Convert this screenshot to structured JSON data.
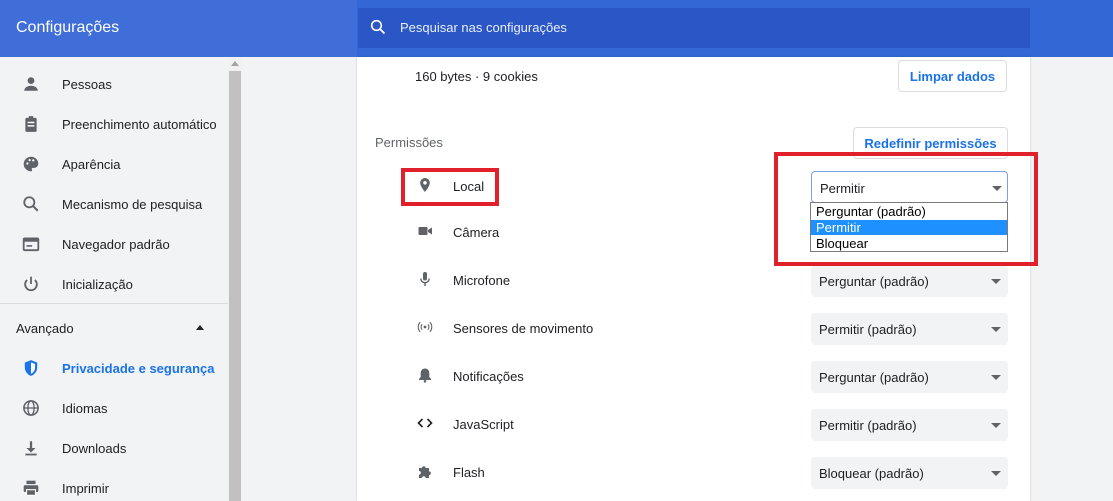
{
  "app": {
    "title": "Configurações"
  },
  "search": {
    "placeholder": "Pesquisar nas configurações"
  },
  "sidebar": {
    "items": [
      {
        "label": "Pessoas",
        "icon": "person-icon"
      },
      {
        "label": "Preenchimento automático",
        "icon": "clipboard-icon"
      },
      {
        "label": "Aparência",
        "icon": "palette-icon"
      },
      {
        "label": "Mecanismo de pesquisa",
        "icon": "search-icon"
      },
      {
        "label": "Navegador padrão",
        "icon": "browser-icon"
      },
      {
        "label": "Inicialização",
        "icon": "power-icon"
      }
    ],
    "advanced_label": "Avançado",
    "advanced_items": [
      {
        "label": "Privacidade e segurança",
        "icon": "shield-icon",
        "active": true
      },
      {
        "label": "Idiomas",
        "icon": "globe-icon"
      },
      {
        "label": "Downloads",
        "icon": "download-icon"
      },
      {
        "label": "Imprimir",
        "icon": "printer-icon"
      }
    ]
  },
  "site": {
    "storage_info": "160 bytes · 9 cookies",
    "clear_button": "Limpar dados",
    "permissions_title": "Permissões",
    "reset_button": "Redefinir permissões"
  },
  "permissions": [
    {
      "label": "Local",
      "value": "Permitir",
      "icon": "location-pin-icon"
    },
    {
      "label": "Câmera",
      "value": "",
      "icon": "camera-icon"
    },
    {
      "label": "Microfone",
      "value": "Perguntar (padrão)",
      "icon": "microphone-icon"
    },
    {
      "label": "Sensores de movimento",
      "value": "Permitir (padrão)",
      "icon": "motion-sensor-icon"
    },
    {
      "label": "Notificações",
      "value": "Perguntar (padrão)",
      "icon": "bell-icon"
    },
    {
      "label": "JavaScript",
      "value": "Permitir (padrão)",
      "icon": "code-icon"
    },
    {
      "label": "Flash",
      "value": "Bloquear (padrão)",
      "icon": "puzzle-icon"
    }
  ],
  "dropdown": {
    "options": [
      "Perguntar (padrão)",
      "Permitir",
      "Bloquear"
    ],
    "selected": "Permitir"
  },
  "colors": {
    "header": "#3367d6",
    "accent": "#1a73e8",
    "highlight": "#e0202a",
    "dropdown_selected": "#1e90ff"
  }
}
